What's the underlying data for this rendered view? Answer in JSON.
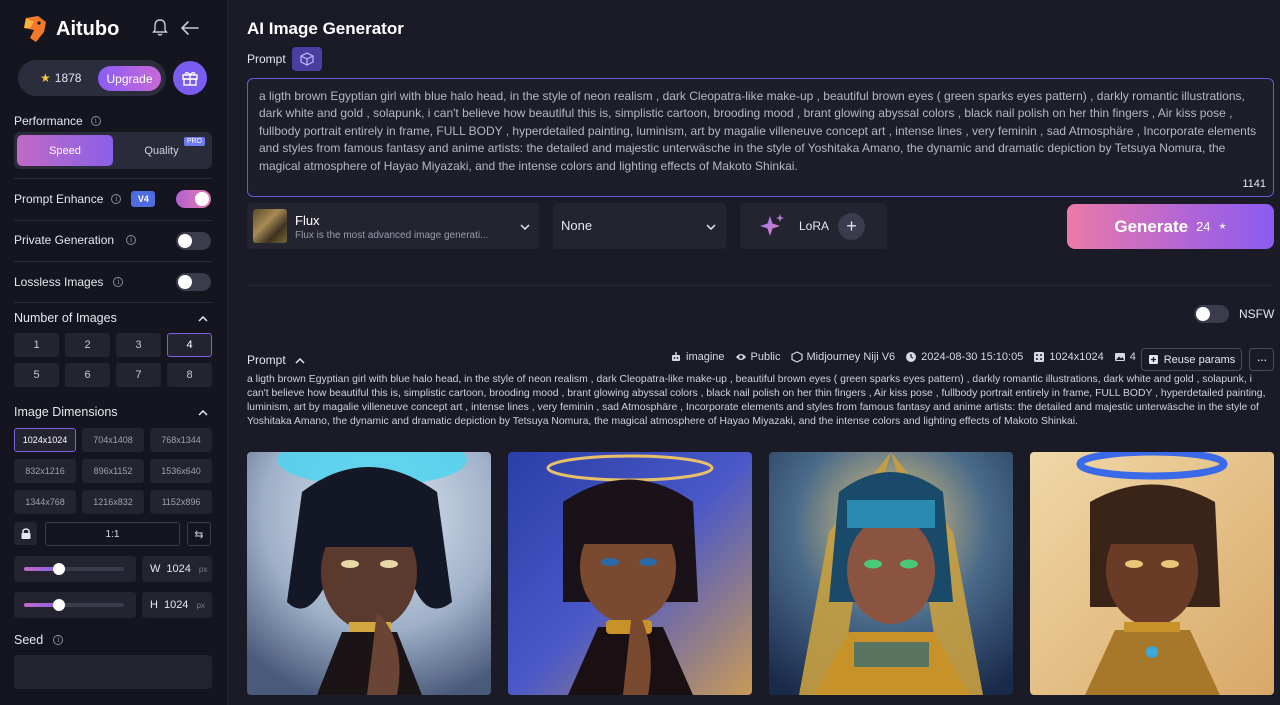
{
  "brand": {
    "name": "Aitubo"
  },
  "account": {
    "credits": "1878",
    "upgrade_label": "Upgrade"
  },
  "performance": {
    "label": "Performance",
    "options": [
      "Speed",
      "Quality"
    ],
    "selected": "Speed",
    "pro_tag": "PRO"
  },
  "prompt_enhance": {
    "label": "Prompt Enhance",
    "badge": "V4",
    "on": true
  },
  "private_generation": {
    "label": "Private Generation",
    "on": false
  },
  "lossless_images": {
    "label": "Lossless Images",
    "on": false
  },
  "number_of_images": {
    "label": "Number of Images",
    "options": [
      "1",
      "2",
      "3",
      "4",
      "5",
      "6",
      "7",
      "8"
    ],
    "selected": "4"
  },
  "image_dimensions": {
    "label": "Image Dimensions",
    "options": [
      "1024x1024",
      "704x1408",
      "768x1344",
      "832x1216",
      "896x1152",
      "1536x640",
      "1344x768",
      "1216x832",
      "1152x896"
    ],
    "selected": "1024x1024",
    "ratio": "1:1",
    "width_label": "W",
    "width": "1024",
    "height_label": "H",
    "height": "1024",
    "unit": "px",
    "width_slider_fraction": 0.35,
    "height_slider_fraction": 0.35
  },
  "seed": {
    "label": "Seed",
    "value": ""
  },
  "main": {
    "title": "AI Image Generator",
    "prompt_label": "Prompt",
    "prompt_text": "a ligth brown Egyptian girl with blue halo head, in the style of neon realism , dark Cleopatra-like make-up , beautiful brown eyes ( green sparks eyes pattern) , darkly romantic illustrations, dark white and gold , solapunk, i can't believe how beautiful this is, simplistic cartoon, brooding mood , brant glowing abyssal colors , black nail polish on her thin fingers , Air kiss pose , fullbody portrait entirely in frame, FULL BODY , hyperdetailed painting, luminism, art by magalie villeneuve concept art , intense lines , very feminin , sad Atmosphäre , Incorporate elements and styles from famous fantasy and anime artists: the detailed and majestic unterwäsche in the style of Yoshitaka Amano, the dynamic and dramatic depiction by Tetsuya Nomura, the magical atmosphere of Hayao Miyazaki, and the intense colors and lighting effects of Makoto Shinkai.",
    "char_count": "1141",
    "model": {
      "name": "Flux",
      "description": "Flux is the most advanced image generati..."
    },
    "style": {
      "value": "None"
    },
    "lora": {
      "label": "LoRA"
    },
    "generate": {
      "label": "Generate",
      "cost": "24"
    },
    "nsfw": {
      "label": "NSFW",
      "on": false
    }
  },
  "result": {
    "prompt_label": "Prompt",
    "meta": {
      "mode": "imagine",
      "visibility": "Public",
      "model": "Midjourney Niji V6",
      "timestamp": "2024-08-30 15:10:05",
      "size": "1024x1024",
      "count": "4"
    },
    "reuse_label": "Reuse params",
    "more_label": "···",
    "prompt_text": "a ligth brown Egyptian girl with blue halo head, in the style of neon realism , dark Cleopatra-like make-up , beautiful brown eyes ( green sparks eyes pattern) , darkly romantic illustrations, dark white and gold , solapunk, i can't believe how beautiful this is, simplistic cartoon, brooding mood , brant glowing abyssal colors , black nail polish on her thin fingers , Air kiss pose , fullbody portrait entirely in frame, FULL BODY , hyperdetailed painting, luminism, art by magalie villeneuve concept art , intense lines , very feminin , sad Atmosphäre , Incorporate elements and styles from famous fantasy and anime artists: the detailed and majestic unterwäsche in the style of Yoshitaka Amano, the dynamic and dramatic depiction by Tetsuya Nomura, the magical atmosphere of Hayao Miyazaki, and the intense colors and lighting effects of Makoto Shinkai."
  },
  "colors": {
    "accent": "#7a62e2",
    "generate_gradient_start": "#ec7aa8",
    "generate_gradient_end": "#8a5cf0"
  },
  "icons": [
    "logo-icon",
    "bell-icon",
    "back-arrow-icon",
    "star-icon",
    "gift-icon",
    "info-icon",
    "chevron-up-icon",
    "lock-icon",
    "swap-icon",
    "cube-icon",
    "chevron-down-icon",
    "sparkle-icon",
    "plus-icon",
    "robot-icon",
    "eye-icon",
    "model-icon",
    "clock-icon",
    "dice-icon",
    "image-icon",
    "reuse-icon",
    "more-icon"
  ]
}
